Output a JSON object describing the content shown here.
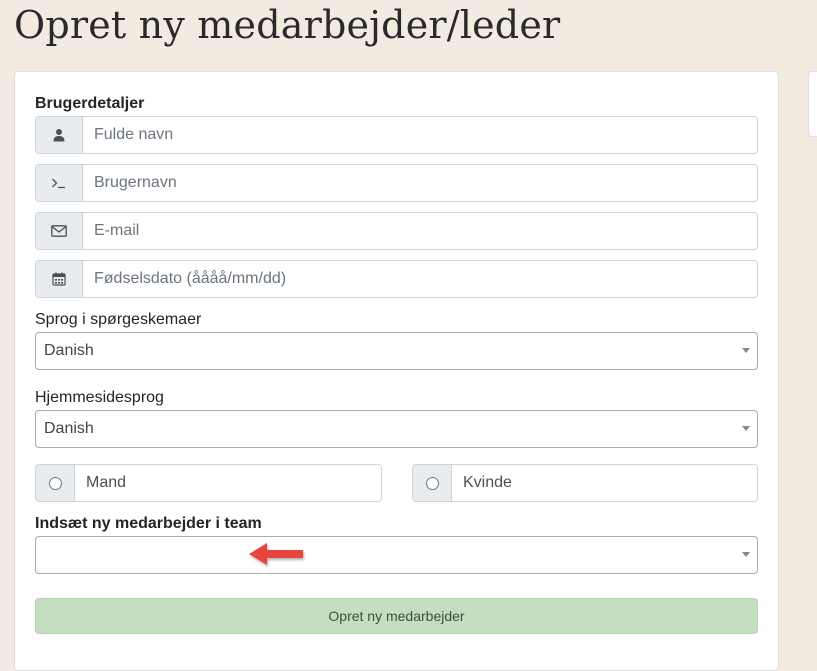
{
  "page": {
    "title": "Opret ny medarbejder/leder"
  },
  "form": {
    "user_details_heading": "Brugerdetaljer",
    "full_name": {
      "placeholder": "Fulde navn",
      "icon": "user-icon"
    },
    "username": {
      "placeholder": "Brugernavn",
      "icon": "terminal-icon"
    },
    "email": {
      "placeholder": "E-mail",
      "icon": "envelope-icon"
    },
    "birthdate": {
      "placeholder": "Fødselsdato (åååå/mm/dd)",
      "icon": "calendar-icon"
    },
    "survey_language": {
      "label": "Sprog i spørgeskemaer",
      "value": "Danish"
    },
    "site_language": {
      "label": "Hjemmesidesprog",
      "value": "Danish"
    },
    "gender": {
      "male": "Mand",
      "female": "Kvinde"
    },
    "team": {
      "label": "Indsæt ny medarbejder i team",
      "value": ""
    },
    "submit_label": "Opret ny medarbejder"
  },
  "colors": {
    "background": "#f3ebe1",
    "submit_button": "#c4dfc0",
    "annotation_arrow": "#e8453c"
  }
}
